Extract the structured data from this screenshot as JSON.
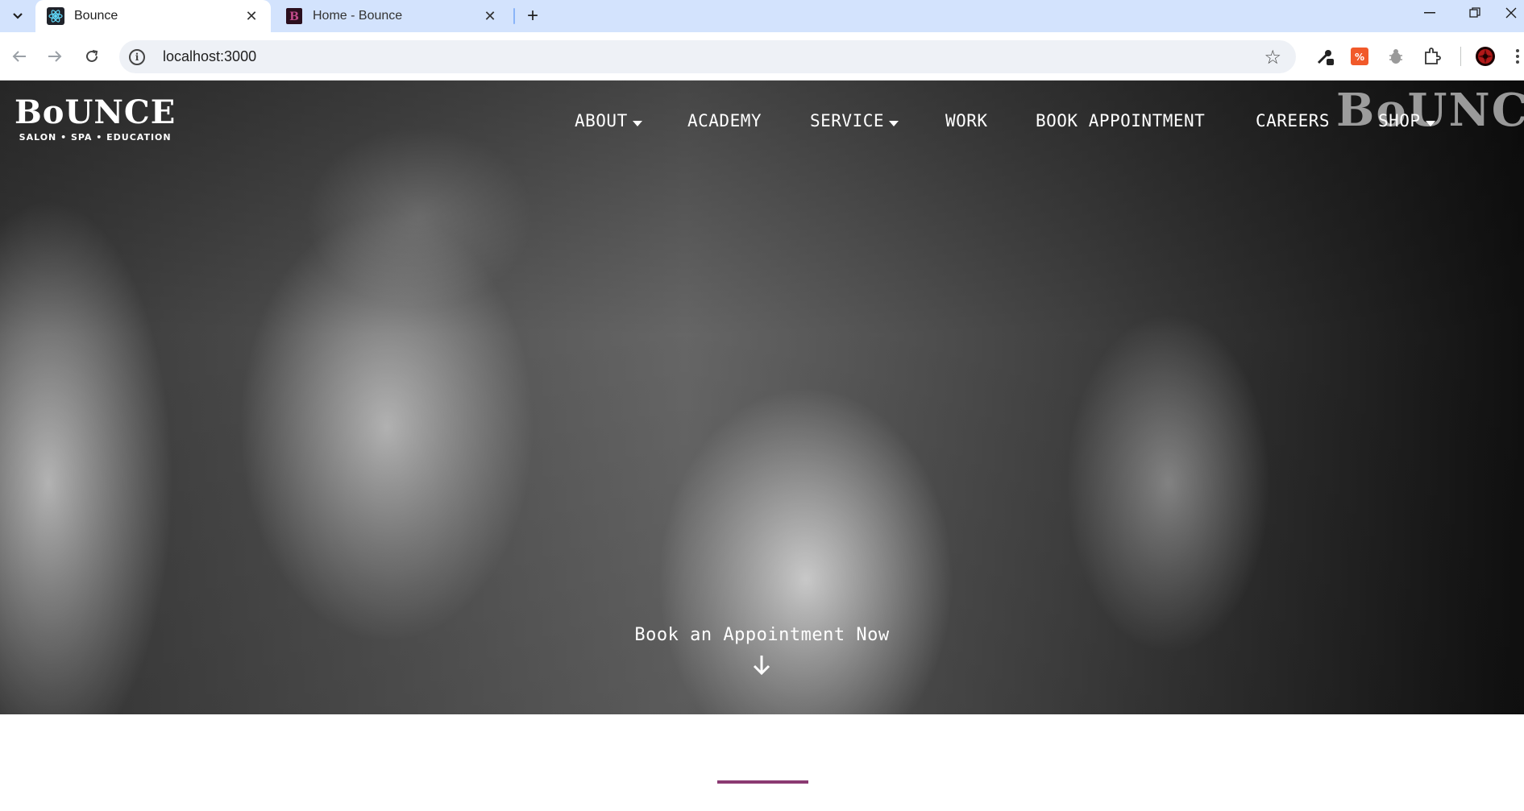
{
  "browser": {
    "tabs": [
      {
        "title": "Bounce",
        "favicon": "react-icon",
        "active": true
      },
      {
        "title": "Home - Bounce",
        "favicon": "bounce-b-icon",
        "active": false
      }
    ],
    "url": "localhost:3000"
  },
  "site": {
    "logo": {
      "word": "BoUNCE",
      "tagline": "SALON • SPA • EDUCATION"
    },
    "watermark": "BoUNCE",
    "nav": [
      {
        "label": "ABOUT",
        "has_dropdown": true
      },
      {
        "label": "ACADEMY",
        "has_dropdown": false
      },
      {
        "label": "SERVICE",
        "has_dropdown": true
      },
      {
        "label": "WORK",
        "has_dropdown": false
      },
      {
        "label": "BOOK APPOINTMENT",
        "has_dropdown": false
      },
      {
        "label": "CAREERS",
        "has_dropdown": false
      },
      {
        "label": "SHOP",
        "has_dropdown": true
      }
    ],
    "cta": {
      "label": "Book an Appointment Now",
      "icon": "arrow-down-icon"
    },
    "accent_color": "#8b3a72"
  }
}
